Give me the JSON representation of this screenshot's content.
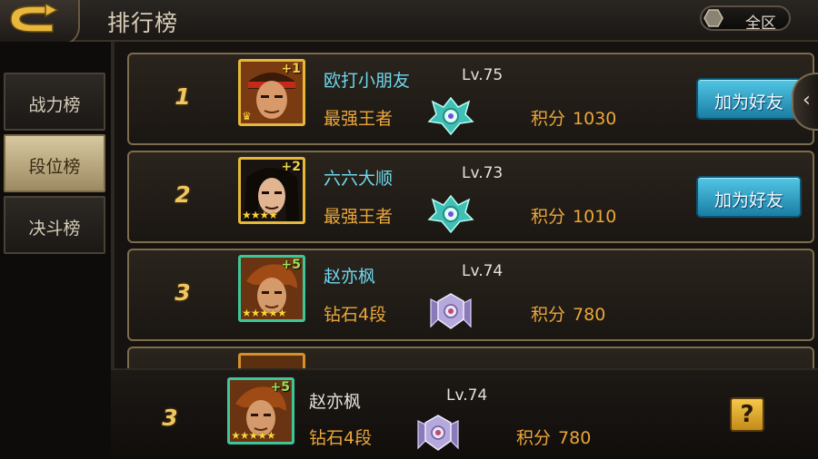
{
  "header": {
    "title": "排行榜",
    "region_label": "全区"
  },
  "tabs": [
    {
      "label": "战力榜",
      "active": false
    },
    {
      "label": "段位榜",
      "active": true
    },
    {
      "label": "决斗榜",
      "active": false
    }
  ],
  "score_label": "积分",
  "add_friend_label": "加为好友",
  "rows": [
    {
      "rank": "1",
      "name": "欧打小朋友",
      "level": "Lv.75",
      "tier": "最强王者",
      "score": "1030",
      "plus": "+1",
      "has_add_friend": true
    },
    {
      "rank": "2",
      "name": "六六大顺",
      "level": "Lv.73",
      "tier": "最强王者",
      "score": "1010",
      "plus": "+2",
      "has_add_friend": true
    },
    {
      "rank": "3",
      "name": "赵亦枫",
      "level": "Lv.74",
      "tier": "钻石4段",
      "score": "780",
      "plus": "+5",
      "has_add_friend": false
    }
  ],
  "self": {
    "rank": "3",
    "name": "赵亦枫",
    "level": "Lv.74",
    "tier": "钻石4段",
    "score": "780",
    "plus": "+5",
    "help_label": "?"
  },
  "colors": {
    "accent_gold": "#f0c660",
    "name_cyan": "#6fd8ee",
    "tier_orange": "#eaa63a",
    "button_blue": "#2f9cc4"
  },
  "icons": {
    "back": "back-arrow-icon",
    "region": "hexagon-icon",
    "collapse": "chevron-left-icon",
    "king_badge": "king-badge-icon",
    "diamond_badge": "diamond-badge-icon",
    "help": "question-icon"
  }
}
